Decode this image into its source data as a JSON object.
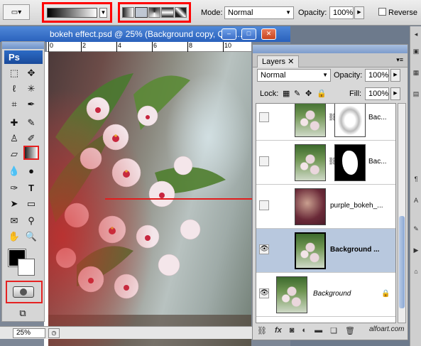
{
  "options_bar": {
    "mode_label": "Mode:",
    "mode_value": "Normal",
    "opacity_label": "Opacity:",
    "opacity_value": "100%",
    "reverse_label": "Reverse"
  },
  "document": {
    "title": "bokeh effect.psd @ 25% (Background copy, Quic...",
    "ruler_ticks": [
      "0",
      "2",
      "4",
      "6",
      "8",
      "10"
    ],
    "zoom": "25%",
    "window_buttons": [
      "–",
      "□",
      "✕"
    ]
  },
  "toolbox": {
    "logo": "Ps"
  },
  "layers_panel": {
    "tab": "Layers",
    "blend_mode": "Normal",
    "opacity_label": "Opacity:",
    "opacity_value": "100%",
    "lock_label": "Lock:",
    "fill_label": "Fill:",
    "fill_value": "100%",
    "layers": [
      {
        "name": "Bac...",
        "visible": false,
        "has_mask": true,
        "mask": "soft"
      },
      {
        "name": "Bac...",
        "visible": false,
        "has_mask": true,
        "mask": "hard"
      },
      {
        "name": "purple_bokeh_...",
        "visible": false,
        "has_mask": false
      },
      {
        "name": "Background ...",
        "visible": true,
        "has_mask": false,
        "selected": true
      },
      {
        "name": "Background",
        "visible": true,
        "locked": true
      }
    ],
    "footer_icons": [
      "link-icon",
      "fx-icon",
      "mask-icon",
      "adjustment-icon",
      "folder-icon",
      "new-layer-icon",
      "trash-icon"
    ]
  },
  "watermark": "alfoart.com",
  "colors": {
    "highlight": "#ff0000",
    "title_bar": "#2a61bc",
    "selected_layer": "#b8c8de"
  }
}
